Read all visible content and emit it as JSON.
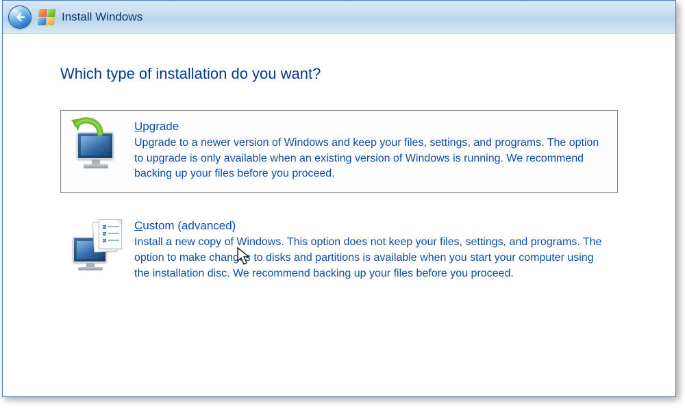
{
  "titlebar": {
    "title": "Install Windows"
  },
  "heading": "Which type of installation do you want?",
  "options": {
    "upgrade": {
      "accel": "U",
      "title_rest": "pgrade",
      "description": "Upgrade to a newer version of Windows and keep your files, settings, and programs. The option to upgrade is only available when an existing version of Windows is running. We recommend backing up your files before you proceed."
    },
    "custom": {
      "accel": "C",
      "title_rest": "ustom (advanced)",
      "description": "Install a new copy of Windows. This option does not keep your files, settings, and programs. The option to make changes to disks and partitions is available when you start your computer using the installation disc. We recommend backing up your files before you proceed."
    }
  }
}
